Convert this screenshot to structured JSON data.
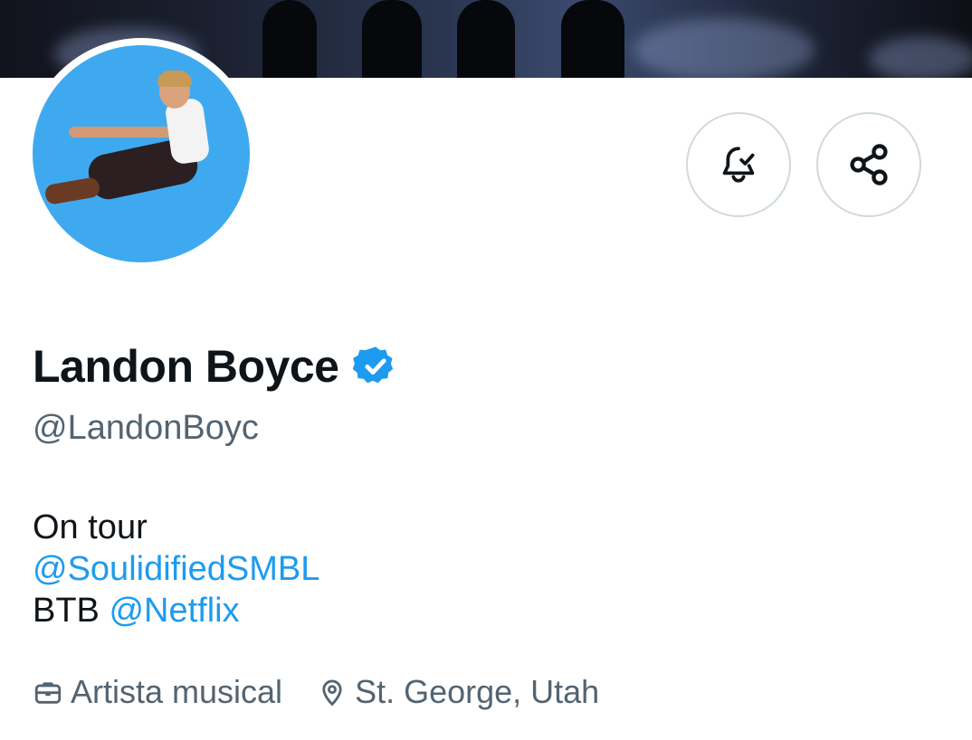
{
  "profile": {
    "display_name": "Landon Boyce",
    "handle": "@LandonBoyc",
    "verified_icon": "verified-badge-icon"
  },
  "bio": {
    "line1": "On tour",
    "link1": "@SoulidifiedSMBL",
    "line3_prefix": "BTB",
    "link2": "@Netflix"
  },
  "meta": {
    "category": "Artista musical",
    "location": "St. George, Utah",
    "category_icon": "briefcase-icon",
    "location_icon": "location-pin-icon"
  },
  "actions": {
    "notify_icon": "bell-check-icon",
    "share_icon": "share-icon"
  },
  "colors": {
    "accent": "#1d9bf0",
    "secondary_text": "#536471",
    "avatar_bg": "#3fa9f0",
    "border": "#cfd9de"
  }
}
